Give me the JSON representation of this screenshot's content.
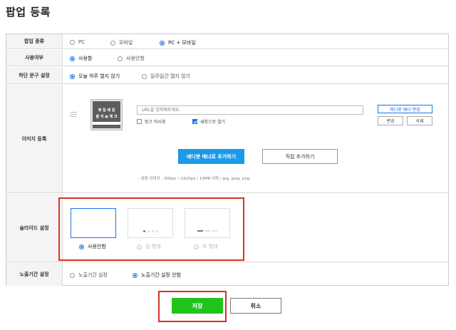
{
  "page": {
    "title": "팝업 등록"
  },
  "rows": {
    "popup_type": {
      "label": "팝업 종류",
      "options": [
        "PC",
        "모바일",
        "PC + 모바일"
      ],
      "selected": "PC + 모바일"
    },
    "usage": {
      "label": "사용여부",
      "options": [
        "사용함",
        "사용안함"
      ],
      "selected": "사용함"
    },
    "bottom_text": {
      "label": "하단 문구 설정",
      "options": [
        "오늘 하루 열지 않기",
        "일주일간 열지 않기"
      ],
      "selected": "오늘 하루 열지 않기"
    },
    "image": {
      "label": "이미지 등록",
      "banner_line1": "매 일 매 일",
      "banner_line2": "출 석 ▣ 체 크",
      "url_placeholder": "URL을 입력해주세요.",
      "no_link_label": "링크 미사용",
      "no_link_checked": false,
      "new_window_label": "새창으로 열기",
      "new_window_checked": true,
      "edit_banner_btn": "에디봇 배너 편집",
      "change_btn": "변경",
      "delete_btn": "삭제",
      "add_editbot_btn": "에디봇 배너로 추가하기",
      "add_direct_btn": "직접 추가하기",
      "hint": "- 권장 이미지 : 300px ~1920px / 10MB 이하 / jpg, jpeg, png"
    },
    "slide": {
      "label": "슬라이드 설정",
      "options": [
        "사용안함",
        "점 형태",
        "바 형태"
      ],
      "selected": "사용안함"
    },
    "exposure": {
      "label": "노출기간 설정",
      "options": [
        "노출기간 설정",
        "노출기간 설정 안함"
      ],
      "selected": "노출기간 설정 안함"
    }
  },
  "footer": {
    "save_label": "저장",
    "cancel_label": "취소"
  },
  "colors": {
    "accent_blue": "#1a73e8",
    "save_green": "#22c41c",
    "highlight_red": "#d9312b"
  }
}
